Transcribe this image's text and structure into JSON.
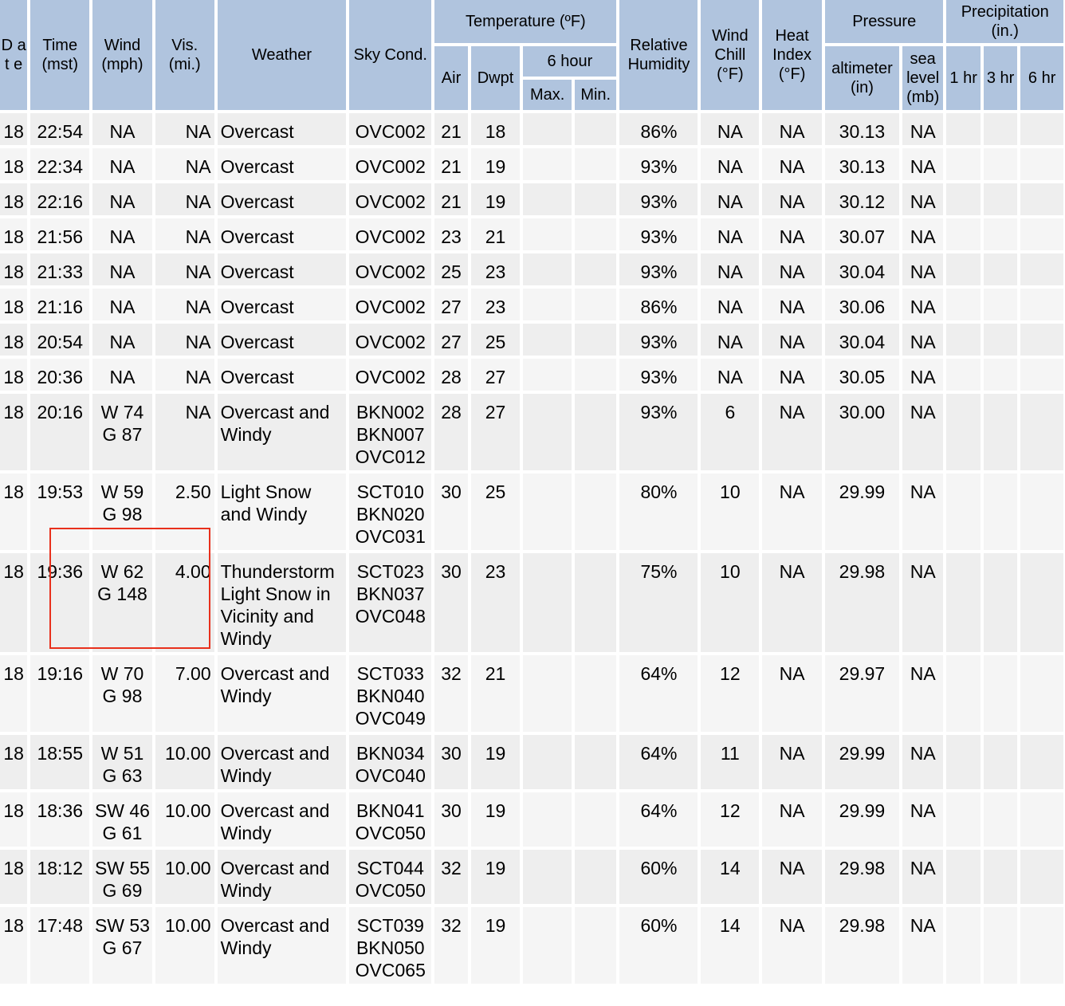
{
  "headers": {
    "date": "D a t e",
    "time": "Time (mst)",
    "wind": "Wind (mph)",
    "vis": "Vis. (mi.)",
    "weather": "Weather",
    "sky": "Sky Cond.",
    "temperature": "Temperature (ºF)",
    "air": "Air",
    "dwpt": "Dwpt",
    "six_hour": "6 hour",
    "max": "Max.",
    "min": "Min.",
    "rh": "Relative Humidity",
    "wind_chill": "Wind Chill (°F)",
    "heat_index": "Heat Index (°F)",
    "pressure": "Pressure",
    "altimeter": "altimeter (in)",
    "sea_level": "sea level (mb)",
    "precip": "Precipitation (in.)",
    "p1": "1 hr",
    "p3": "3 hr",
    "p6": "6 hr"
  },
  "rows": [
    {
      "date": "18",
      "time": "22:54",
      "wind": "NA",
      "vis": "NA",
      "weather": "Overcast",
      "sky": "OVC002",
      "air": "21",
      "dwpt": "18",
      "max": "",
      "min": "",
      "rh": "86%",
      "chill": "NA",
      "heat": "NA",
      "alt": "30.13",
      "sea": "NA",
      "p1": "",
      "p3": "",
      "p6": ""
    },
    {
      "date": "18",
      "time": "22:34",
      "wind": "NA",
      "vis": "NA",
      "weather": "Overcast",
      "sky": "OVC002",
      "air": "21",
      "dwpt": "19",
      "max": "",
      "min": "",
      "rh": "93%",
      "chill": "NA",
      "heat": "NA",
      "alt": "30.13",
      "sea": "NA",
      "p1": "",
      "p3": "",
      "p6": ""
    },
    {
      "date": "18",
      "time": "22:16",
      "wind": "NA",
      "vis": "NA",
      "weather": "Overcast",
      "sky": "OVC002",
      "air": "21",
      "dwpt": "19",
      "max": "",
      "min": "",
      "rh": "93%",
      "chill": "NA",
      "heat": "NA",
      "alt": "30.12",
      "sea": "NA",
      "p1": "",
      "p3": "",
      "p6": ""
    },
    {
      "date": "18",
      "time": "21:56",
      "wind": "NA",
      "vis": "NA",
      "weather": "Overcast",
      "sky": "OVC002",
      "air": "23",
      "dwpt": "21",
      "max": "",
      "min": "",
      "rh": "93%",
      "chill": "NA",
      "heat": "NA",
      "alt": "30.07",
      "sea": "NA",
      "p1": "",
      "p3": "",
      "p6": ""
    },
    {
      "date": "18",
      "time": "21:33",
      "wind": "NA",
      "vis": "NA",
      "weather": "Overcast",
      "sky": "OVC002",
      "air": "25",
      "dwpt": "23",
      "max": "",
      "min": "",
      "rh": "93%",
      "chill": "NA",
      "heat": "NA",
      "alt": "30.04",
      "sea": "NA",
      "p1": "",
      "p3": "",
      "p6": ""
    },
    {
      "date": "18",
      "time": "21:16",
      "wind": "NA",
      "vis": "NA",
      "weather": "Overcast",
      "sky": "OVC002",
      "air": "27",
      "dwpt": "23",
      "max": "",
      "min": "",
      "rh": "86%",
      "chill": "NA",
      "heat": "NA",
      "alt": "30.06",
      "sea": "NA",
      "p1": "",
      "p3": "",
      "p6": ""
    },
    {
      "date": "18",
      "time": "20:54",
      "wind": "NA",
      "vis": "NA",
      "weather": "Overcast",
      "sky": "OVC002",
      "air": "27",
      "dwpt": "25",
      "max": "",
      "min": "",
      "rh": "93%",
      "chill": "NA",
      "heat": "NA",
      "alt": "30.04",
      "sea": "NA",
      "p1": "",
      "p3": "",
      "p6": ""
    },
    {
      "date": "18",
      "time": "20:36",
      "wind": "NA",
      "vis": "NA",
      "weather": "Overcast",
      "sky": "OVC002",
      "air": "28",
      "dwpt": "27",
      "max": "",
      "min": "",
      "rh": "93%",
      "chill": "NA",
      "heat": "NA",
      "alt": "30.05",
      "sea": "NA",
      "p1": "",
      "p3": "",
      "p6": ""
    },
    {
      "date": "18",
      "time": "20:16",
      "wind": "W 74 G 87",
      "vis": "NA",
      "weather": "Overcast and Windy",
      "sky": "BKN002 BKN007 OVC012",
      "air": "28",
      "dwpt": "27",
      "max": "",
      "min": "",
      "rh": "93%",
      "chill": "6",
      "heat": "NA",
      "alt": "30.00",
      "sea": "NA",
      "p1": "",
      "p3": "",
      "p6": ""
    },
    {
      "date": "18",
      "time": "19:53",
      "wind": "W 59 G 98",
      "vis": "2.50",
      "weather": "Light Snow and Windy",
      "sky": "SCT010 BKN020 OVC031",
      "air": "30",
      "dwpt": "25",
      "max": "",
      "min": "",
      "rh": "80%",
      "chill": "10",
      "heat": "NA",
      "alt": "29.99",
      "sea": "NA",
      "p1": "",
      "p3": "",
      "p6": ""
    },
    {
      "date": "18",
      "time": "19:36",
      "wind": "W 62 G 148",
      "vis": "4.00",
      "weather": "Thunderstorm Light Snow in Vicinity and Windy",
      "sky": "SCT023 BKN037 OVC048",
      "air": "30",
      "dwpt": "23",
      "max": "",
      "min": "",
      "rh": "75%",
      "chill": "10",
      "heat": "NA",
      "alt": "29.98",
      "sea": "NA",
      "p1": "",
      "p3": "",
      "p6": ""
    },
    {
      "date": "18",
      "time": "19:16",
      "wind": "W 70 G 98",
      "vis": "7.00",
      "weather": "Overcast and Windy",
      "sky": "SCT033 BKN040 OVC049",
      "air": "32",
      "dwpt": "21",
      "max": "",
      "min": "",
      "rh": "64%",
      "chill": "12",
      "heat": "NA",
      "alt": "29.97",
      "sea": "NA",
      "p1": "",
      "p3": "",
      "p6": ""
    },
    {
      "date": "18",
      "time": "18:55",
      "wind": "W 51 G 63",
      "vis": "10.00",
      "weather": "Overcast and Windy",
      "sky": "BKN034 OVC040",
      "air": "30",
      "dwpt": "19",
      "max": "",
      "min": "",
      "rh": "64%",
      "chill": "11",
      "heat": "NA",
      "alt": "29.99",
      "sea": "NA",
      "p1": "",
      "p3": "",
      "p6": ""
    },
    {
      "date": "18",
      "time": "18:36",
      "wind": "SW 46 G 61",
      "vis": "10.00",
      "weather": "Overcast and Windy",
      "sky": "BKN041 OVC050",
      "air": "30",
      "dwpt": "19",
      "max": "",
      "min": "",
      "rh": "64%",
      "chill": "12",
      "heat": "NA",
      "alt": "29.99",
      "sea": "NA",
      "p1": "",
      "p3": "",
      "p6": ""
    },
    {
      "date": "18",
      "time": "18:12",
      "wind": "SW 55 G 69",
      "vis": "10.00",
      "weather": "Overcast and Windy",
      "sky": "SCT044 OVC050",
      "air": "32",
      "dwpt": "19",
      "max": "",
      "min": "",
      "rh": "60%",
      "chill": "14",
      "heat": "NA",
      "alt": "29.98",
      "sea": "NA",
      "p1": "",
      "p3": "",
      "p6": ""
    },
    {
      "date": "18",
      "time": "17:48",
      "wind": "SW 53 G 67",
      "vis": "10.00",
      "weather": "Overcast and Windy",
      "sky": "SCT039 BKN050 OVC065",
      "air": "32",
      "dwpt": "19",
      "max": "",
      "min": "",
      "rh": "60%",
      "chill": "14",
      "heat": "NA",
      "alt": "29.98",
      "sea": "NA",
      "p1": "",
      "p3": "",
      "p6": ""
    }
  ],
  "highlight_color": "#e8301c",
  "header_color": "#b0c4de"
}
